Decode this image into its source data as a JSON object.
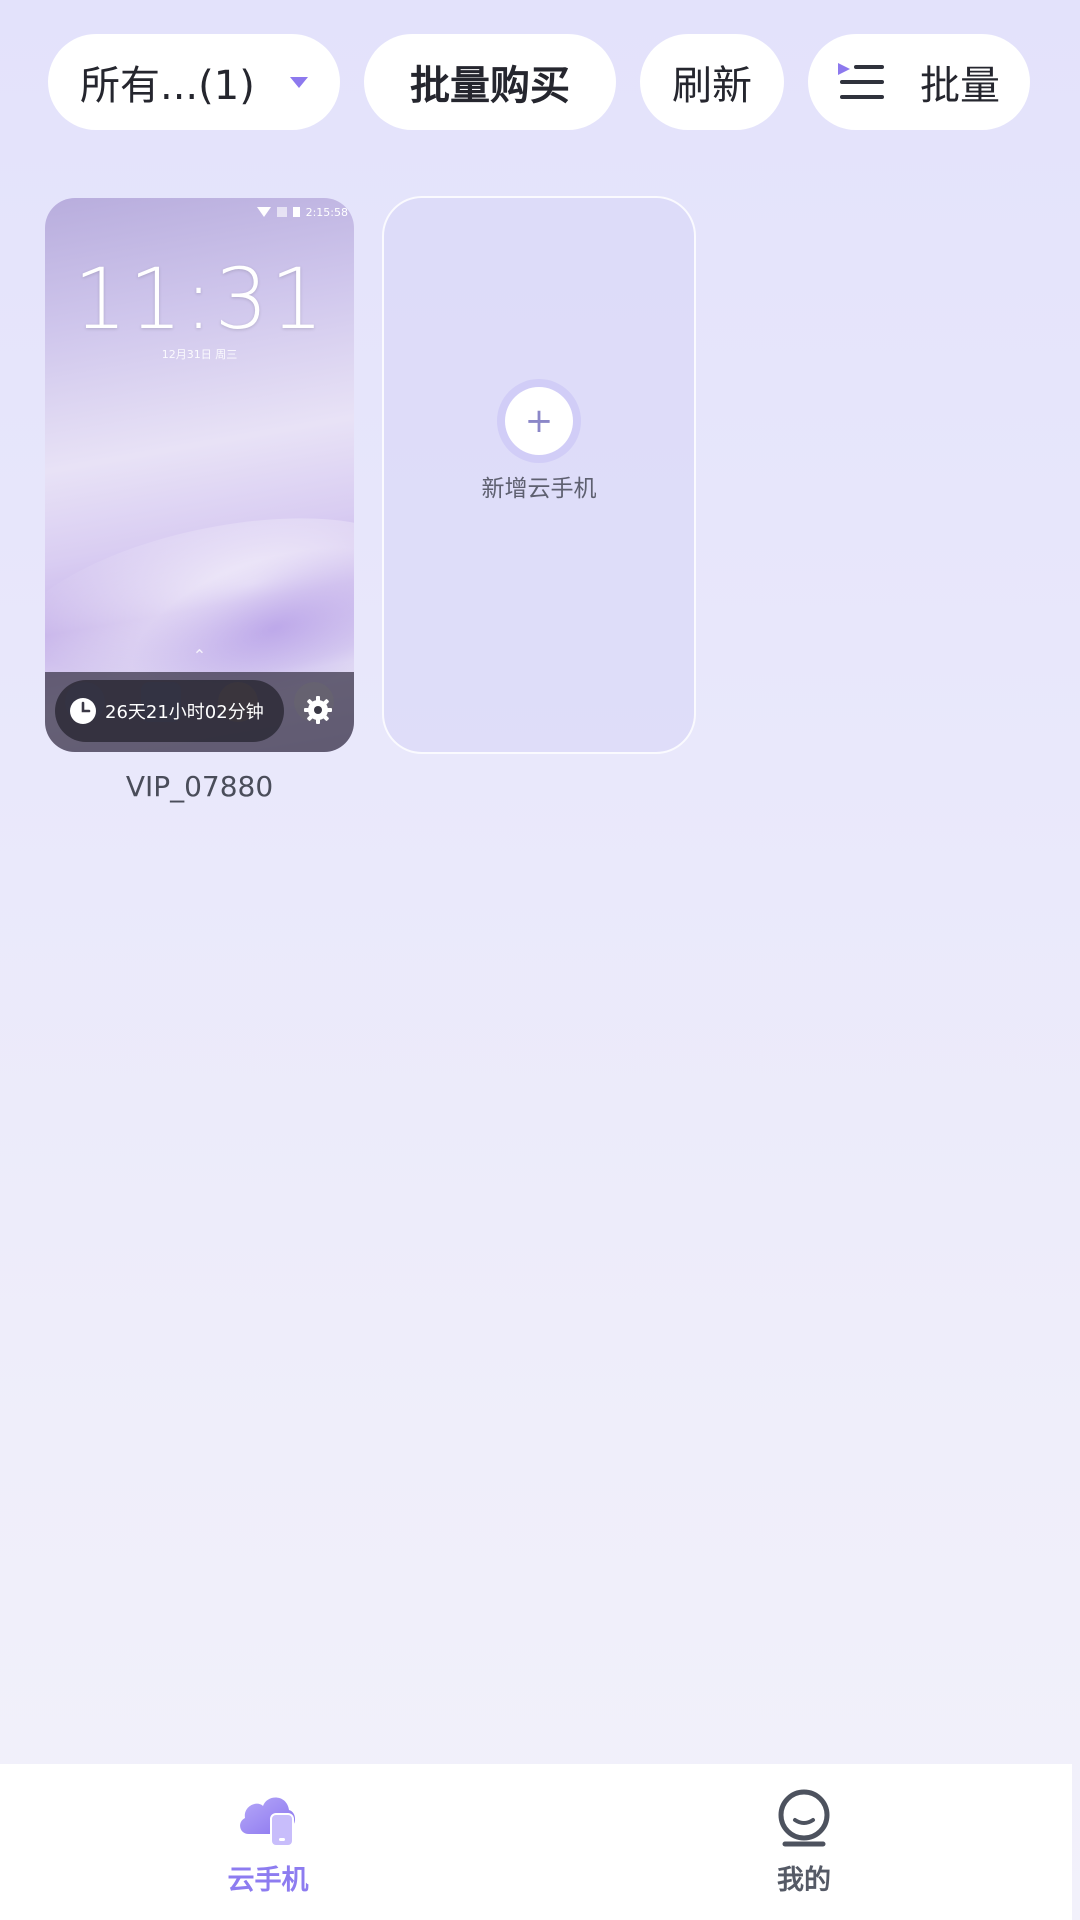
{
  "toolbar": {
    "filter_label": "所有...(1)",
    "buy_label": "批量购买",
    "refresh_label": "刷新",
    "batch_label": "批量"
  },
  "device": {
    "name": "VIP_07880",
    "lock_time": "11:31",
    "lock_date": "12月31日 周三",
    "status_time": "2:15:58",
    "remaining_time": "26天21小时02分钟"
  },
  "add_card": {
    "label": "新增云手机"
  },
  "nav": {
    "items": [
      {
        "label": "云手机",
        "icon": "cloud-phone-icon",
        "active": true
      },
      {
        "label": "我的",
        "icon": "profile-icon",
        "active": false
      }
    ]
  },
  "colors": {
    "accent": "#8d7cf0",
    "background": "#e8e7fb",
    "chip": "#ffffff"
  }
}
